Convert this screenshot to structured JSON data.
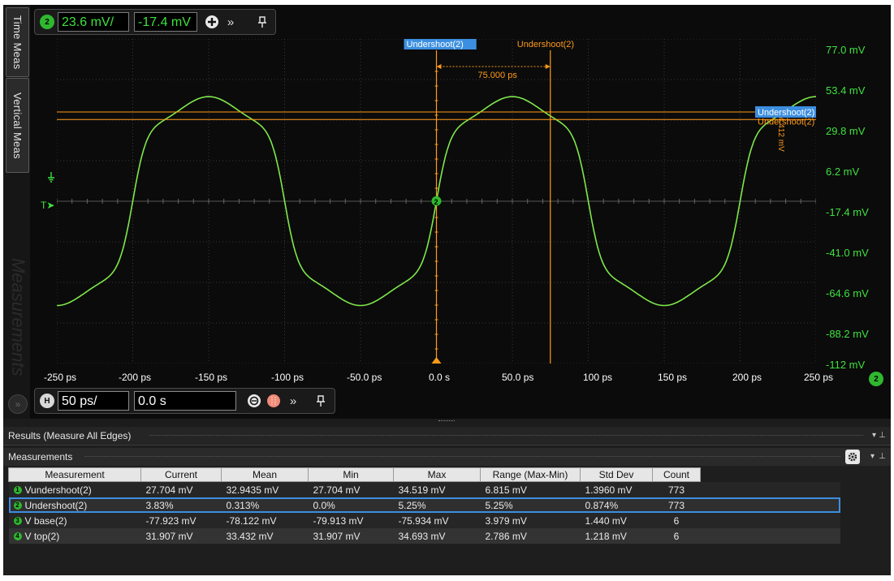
{
  "sidebar": {
    "tabs": [
      "Time Meas",
      "Vertical Meas"
    ],
    "measurements_tab": "Measurements",
    "expand_icon": "double-chevron-icon"
  },
  "top_toolbar": {
    "channel": "2",
    "scale": "23.6 mV/",
    "offset": "-17.4 mV",
    "add_icon": "plus-circle-icon",
    "more_icon": "double-chevron-icon",
    "pin_icon": "pin-icon"
  },
  "plot": {
    "y_labels": [
      "77.0 mV",
      "53.4 mV",
      "29.8 mV",
      "6.2 mV",
      "-17.4 mV",
      "-41.0 mV",
      "-64.6 mV",
      "-88.2 mV",
      "-112 mV"
    ],
    "x_labels": [
      "-250 ps",
      "-200 ps",
      "-150 ps",
      "-100 ps",
      "-50.0 ps",
      "0.0 s",
      "50.0 ps",
      "100 ps",
      "150 ps",
      "200 ps",
      "250 ps"
    ],
    "trigger_marker": "T",
    "channel_marker": "2",
    "marker_left_label": "Undershoot(2)",
    "marker_right_label": "Undershoot(2)",
    "delta_time": "75.000 ps",
    "hmarker_top_label": "Undershoot(2)",
    "hmarker_bottom_label": "Undershoot(2)",
    "delta_v": "4.412 mV"
  },
  "bottom_toolbar": {
    "h_badge": "H",
    "timebase": "50 ps/",
    "position": "0.0 s",
    "zoom_icon": "zoom-icon",
    "run_icon": "acquisition-icon",
    "more_icon": "double-chevron-icon",
    "pin_icon": "pin-icon"
  },
  "results": {
    "title": "Results  (Measure All Edges)",
    "measurements_title": "Measurements",
    "columns": [
      "Measurement",
      "Current",
      "Mean",
      "Min",
      "Max",
      "Range (Max-Min)",
      "Std Dev",
      "Count"
    ],
    "rows": [
      {
        "n": "1",
        "name": "Vundershoot(2)",
        "current": "27.704 mV",
        "mean": "32.9435 mV",
        "min": "27.704 mV",
        "max": "34.519 mV",
        "range": "6.815 mV",
        "std": "1.3960 mV",
        "count": "773"
      },
      {
        "n": "2",
        "name": "Undershoot(2)",
        "current": "3.83%",
        "mean": "0.313%",
        "min": "0.0%",
        "max": "5.25%",
        "range": "5.25%",
        "std": "0.874%",
        "count": "773"
      },
      {
        "n": "3",
        "name": "V base(2)",
        "current": "-77.923 mV",
        "mean": "-78.122 mV",
        "min": "-79.913 mV",
        "max": "-75.934 mV",
        "range": "3.979 mV",
        "std": "1.440 mV",
        "count": "6"
      },
      {
        "n": "4",
        "name": "V top(2)",
        "current": "31.907 mV",
        "mean": "33.432 mV",
        "min": "31.907 mV",
        "max": "34.693 mV",
        "range": "2.786 mV",
        "std": "1.218 mV",
        "count": "6"
      }
    ]
  },
  "colors": {
    "trace": "#7ee84a",
    "marker": "#ff9a1a",
    "accent": "#3c8fe0",
    "label_green": "#3ee23e"
  }
}
